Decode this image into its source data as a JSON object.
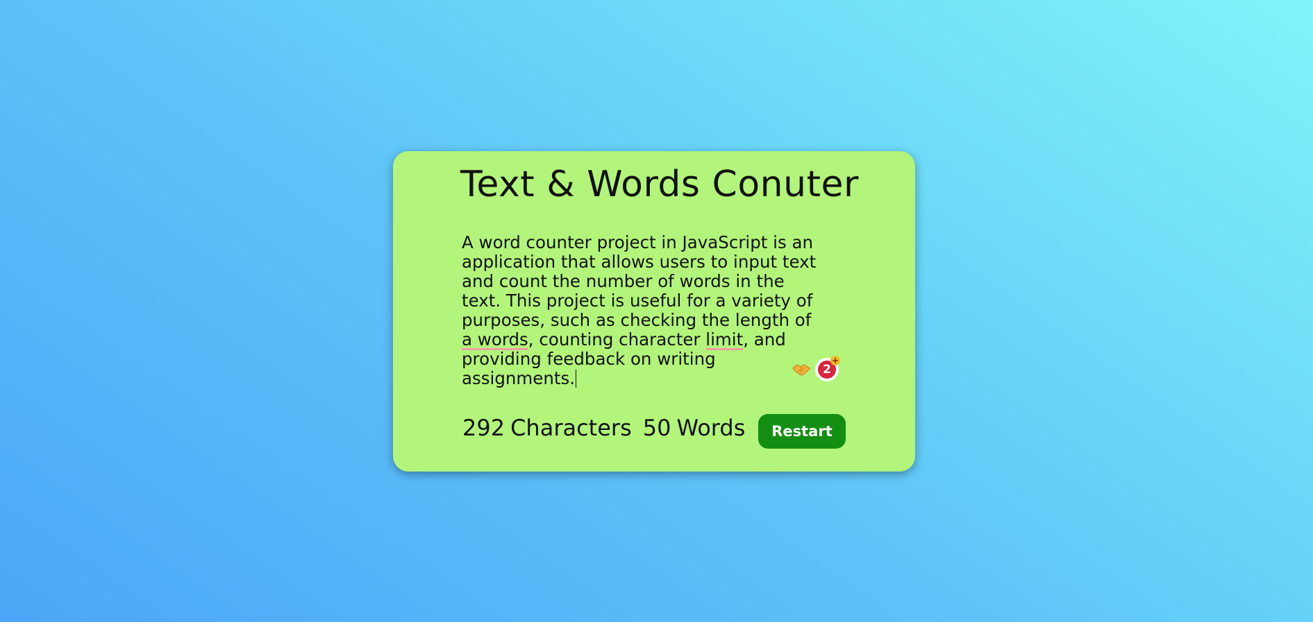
{
  "app": {
    "title": "Text & Words Conuter"
  },
  "editor": {
    "lines": [
      {
        "parts": [
          {
            "text": "A word counter project in JavaScript is an",
            "flag": false
          }
        ]
      },
      {
        "parts": [
          {
            "text": "application that allows users to input text",
            "flag": false
          }
        ]
      },
      {
        "parts": [
          {
            "text": "and count the number of words in the",
            "flag": false
          }
        ]
      },
      {
        "parts": [
          {
            "text": "text. This project is useful for a variety of",
            "flag": false
          }
        ]
      },
      {
        "parts": [
          {
            "text": "purposes, such as checking the length of",
            "flag": false
          }
        ]
      },
      {
        "parts": [
          {
            "text": "a words",
            "flag": true
          },
          {
            "text": ", counting character ",
            "flag": false
          },
          {
            "text": "limit",
            "flag": true
          },
          {
            "text": ", and",
            "flag": false
          }
        ]
      },
      {
        "parts": [
          {
            "text": "providing feedback on writing",
            "flag": false
          }
        ]
      },
      {
        "parts": [
          {
            "text": "assignments.",
            "flag": false
          }
        ]
      }
    ],
    "grammar_badge_count": "2",
    "grammar_badge_plus": "+",
    "icons": [
      "handshake-icon",
      "grammar-check-icon"
    ]
  },
  "stats": {
    "characters_count": "292",
    "characters_label": "Characters",
    "words_count": "50",
    "words_label": "Words"
  },
  "actions": {
    "restart_label": "Restart"
  },
  "colors": {
    "card_background": "#b2f57a",
    "button_background": "#138e13",
    "spelling_underline": "#f09aa6",
    "badge_red": "#d7263d"
  }
}
